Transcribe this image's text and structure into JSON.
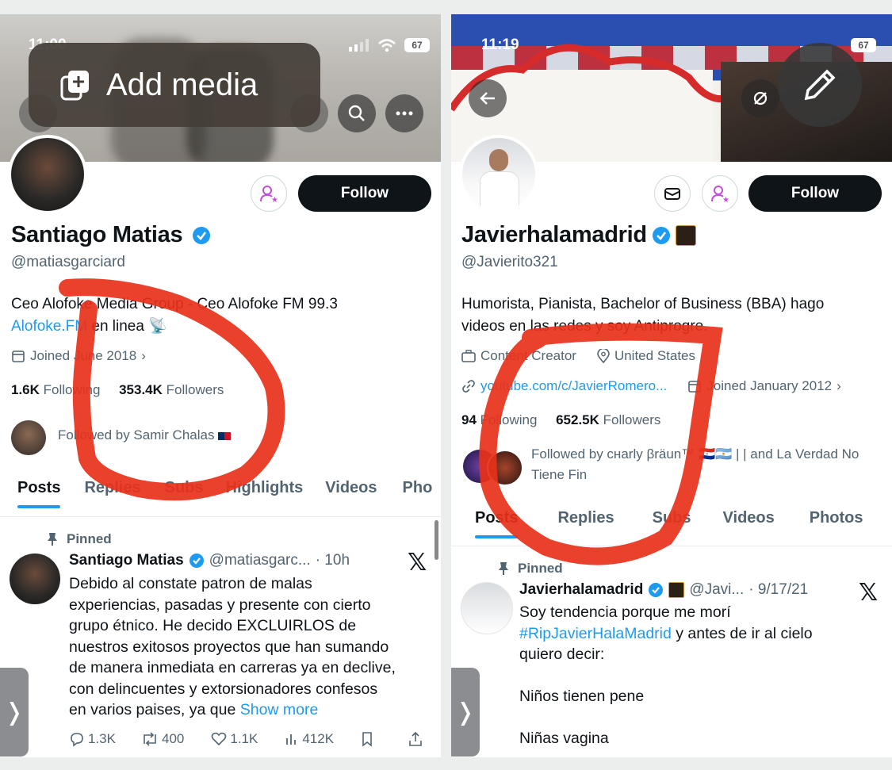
{
  "left": {
    "status_time": "11:00",
    "battery": "67",
    "add_media_label": "Add media",
    "name": "Santiago Matias",
    "handle": "@matiasgarciard",
    "bio_line1": "Ceo Alofoke Media Group - Ceo Alofoke FM 99.3",
    "bio_link": "Alofoke.FM",
    "bio_line2_rest": " en linea 📡",
    "joined": "Joined June 2018",
    "following_count": "1.6K",
    "following_label": "Following",
    "followers_count": "353.4K",
    "followers_label": "Followers",
    "followed_by": "Followed by Samir Chalas",
    "follow_label": "Follow",
    "tabs": [
      "Posts",
      "Replies",
      "Subs",
      "Highlights",
      "Videos",
      "Pho"
    ],
    "pinned_label": "Pinned",
    "tweet": {
      "name": "Santiago Matias",
      "handle": "@matiasgarc...",
      "time": "· 10h",
      "lines": [
        "Debido al constate patron de malas",
        "experiencias, pasadas y presente con cierto",
        "grupo étnico. He decido EXCLUIRLOS de",
        "nuestros exitosos proyectos que han sumando",
        "de manera inmediata en carreras ya en declive,",
        "con delincuentes y extorsionadores confesos"
      ],
      "last_line": "en varios paises, ya que ",
      "show_more": "Show more",
      "replies": "1.3K",
      "reposts": "400",
      "likes": "1.1K",
      "views": "412K"
    }
  },
  "right": {
    "status_time": "11:19",
    "battery": "67",
    "name": "Javierhalamadrid",
    "handle": "@Javierito321",
    "bio_line1": "Humorista, Pianista, Bachelor of Business (BBA) hago",
    "bio_line2": "videos en las redes y soy Antiprogre.",
    "category": "Content Creator",
    "location": "United States",
    "website": "youtube.com/c/JavierRomero...",
    "joined": "Joined January 2012",
    "following_count": "94",
    "following_label": "Following",
    "followers_count": "652.5K",
    "followers_label": "Followers",
    "followed_by_line1": "Followed by cнarly βräun™ 🇵🇾🇦🇷 |  | and La Verdad No",
    "followed_by_line2": "Tiene Fin",
    "follow_label": "Follow",
    "tabs": [
      "Posts",
      "Replies",
      "Subs",
      "Videos",
      "Photos"
    ],
    "pinned_label": "Pinned",
    "tweet": {
      "name": "Javierhalamadrid",
      "handle": "@Javi...",
      "time": "· 9/17/21",
      "line1": "Soy tendencia porque me morí",
      "hashtag": "#RipJavierHalaMadrid",
      "line2_rest": " y antes de ir al cielo",
      "line3": "quiero decir:",
      "line4": "Niños tienen pene",
      "line5": "Niñas vagina"
    }
  },
  "colors": {
    "accent": "#1d9bf0",
    "follow_bg": "#0f1419",
    "verified": "#1d9bf0",
    "annotation": "#e8311a",
    "subscribe_icon": "#c34ed8"
  }
}
